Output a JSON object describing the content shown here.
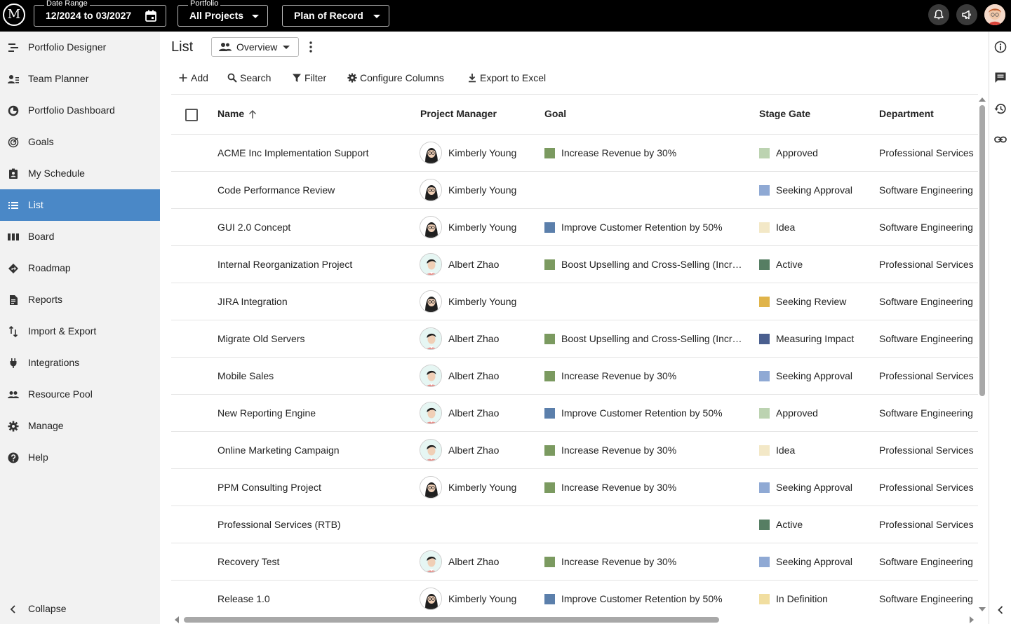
{
  "topbar": {
    "logo": "M",
    "date_range": {
      "label": "Date Range",
      "value": "12/2024 to 03/2027"
    },
    "portfolio": {
      "label": "Portfolio",
      "value": "All Projects"
    },
    "scenario": {
      "value": "Plan of Record"
    },
    "icons": [
      "bell-icon",
      "megaphone-icon",
      "user-avatar"
    ]
  },
  "sidebar": {
    "items": [
      {
        "label": "Portfolio Designer",
        "icon": "portfolio-designer-icon"
      },
      {
        "label": "Team Planner",
        "icon": "team-planner-icon"
      },
      {
        "label": "Portfolio Dashboard",
        "icon": "dashboard-icon"
      },
      {
        "label": "Goals",
        "icon": "goals-icon"
      },
      {
        "label": "My Schedule",
        "icon": "schedule-icon"
      },
      {
        "label": "List",
        "icon": "list-icon",
        "active": true
      },
      {
        "label": "Board",
        "icon": "board-icon"
      },
      {
        "label": "Roadmap",
        "icon": "roadmap-icon"
      },
      {
        "label": "Reports",
        "icon": "reports-icon"
      },
      {
        "label": "Import & Export",
        "icon": "import-export-icon"
      },
      {
        "label": "Integrations",
        "icon": "plug-icon"
      },
      {
        "label": "Resource Pool",
        "icon": "people-icon"
      },
      {
        "label": "Manage",
        "icon": "gear-icon"
      },
      {
        "label": "Help",
        "icon": "help-icon"
      }
    ],
    "collapse_label": "Collapse"
  },
  "page": {
    "title": "List",
    "view_selector": "Overview"
  },
  "toolbar": {
    "add": "Add",
    "search": "Search",
    "filter": "Filter",
    "configure_columns": "Configure Columns",
    "export": "Export to Excel"
  },
  "table": {
    "columns": [
      "Name",
      "Project Manager",
      "Goal",
      "Stage Gate",
      "Department"
    ],
    "rows": [
      {
        "name": "ACME Inc Implementation Support",
        "pm": "Kimberly Young",
        "pm_avatar": "female",
        "goal": "Increase Revenue by 30%",
        "goal_color": "#7b9a60",
        "stage": "Approved",
        "stage_color": "#bcd3b1",
        "dept": "Professional Services"
      },
      {
        "name": "Code Performance Review",
        "pm": "Kimberly Young",
        "pm_avatar": "female",
        "goal": "",
        "goal_color": "",
        "stage": "Seeking Approval",
        "stage_color": "#8fa9d4",
        "dept": "Software Engineering"
      },
      {
        "name": "GUI 2.0 Concept",
        "pm": "Kimberly Young",
        "pm_avatar": "female",
        "goal": "Improve Customer Retention by 50%",
        "goal_color": "#5b7fab",
        "stage": "Idea",
        "stage_color": "#f3e8c7",
        "dept": "Software Engineering"
      },
      {
        "name": "Internal Reorganization Project",
        "pm": "Albert Zhao",
        "pm_avatar": "male",
        "goal": "Boost Upselling and Cross-Selling (Incr…",
        "goal_color": "#7b9a60",
        "stage": "Active",
        "stage_color": "#567e63",
        "dept": "Professional Services"
      },
      {
        "name": "JIRA Integration",
        "pm": "Kimberly Young",
        "pm_avatar": "female",
        "goal": "",
        "goal_color": "",
        "stage": "Seeking Review",
        "stage_color": "#e0b44a",
        "dept": "Software Engineering"
      },
      {
        "name": "Migrate Old Servers",
        "pm": "Albert Zhao",
        "pm_avatar": "male",
        "goal": "Boost Upselling and Cross-Selling (Incr…",
        "goal_color": "#7b9a60",
        "stage": "Measuring Impact",
        "stage_color": "#4a5f8f",
        "dept": "Software Engineering"
      },
      {
        "name": "Mobile Sales",
        "pm": "Albert Zhao",
        "pm_avatar": "male",
        "goal": "Increase Revenue by 30%",
        "goal_color": "#7b9a60",
        "stage": "Seeking Approval",
        "stage_color": "#8fa9d4",
        "dept": "Professional Services"
      },
      {
        "name": "New Reporting Engine",
        "pm": "Albert Zhao",
        "pm_avatar": "male",
        "goal": "Improve Customer Retention by 50%",
        "goal_color": "#5b7fab",
        "stage": "Approved",
        "stage_color": "#bcd3b1",
        "dept": "Software Engineering"
      },
      {
        "name": "Online Marketing Campaign",
        "pm": "Albert Zhao",
        "pm_avatar": "male",
        "goal": "Increase Revenue by 30%",
        "goal_color": "#7b9a60",
        "stage": "Idea",
        "stage_color": "#f3e8c7",
        "dept": "Professional Services"
      },
      {
        "name": "PPM Consulting Project",
        "pm": "Kimberly Young",
        "pm_avatar": "female",
        "goal": "Increase Revenue by 30%",
        "goal_color": "#7b9a60",
        "stage": "Seeking Approval",
        "stage_color": "#8fa9d4",
        "dept": "Professional Services"
      },
      {
        "name": "Professional Services (RTB)",
        "pm": "",
        "pm_avatar": "",
        "goal": "",
        "goal_color": "",
        "stage": "Active",
        "stage_color": "#567e63",
        "dept": "Professional Services"
      },
      {
        "name": "Recovery Test",
        "pm": "Albert Zhao",
        "pm_avatar": "male",
        "goal": "Increase Revenue by 30%",
        "goal_color": "#7b9a60",
        "stage": "Seeking Approval",
        "stage_color": "#8fa9d4",
        "dept": "Software Engineering"
      },
      {
        "name": "Release 1.0",
        "pm": "Kimberly Young",
        "pm_avatar": "female",
        "goal": "Improve Customer Retention by 50%",
        "goal_color": "#5b7fab",
        "stage": "In Definition",
        "stage_color": "#f1dea0",
        "dept": "Software Engineering"
      }
    ]
  },
  "right_rail": [
    "info-icon",
    "comments-icon",
    "history-icon",
    "link-icon",
    "chevron-left-icon"
  ]
}
